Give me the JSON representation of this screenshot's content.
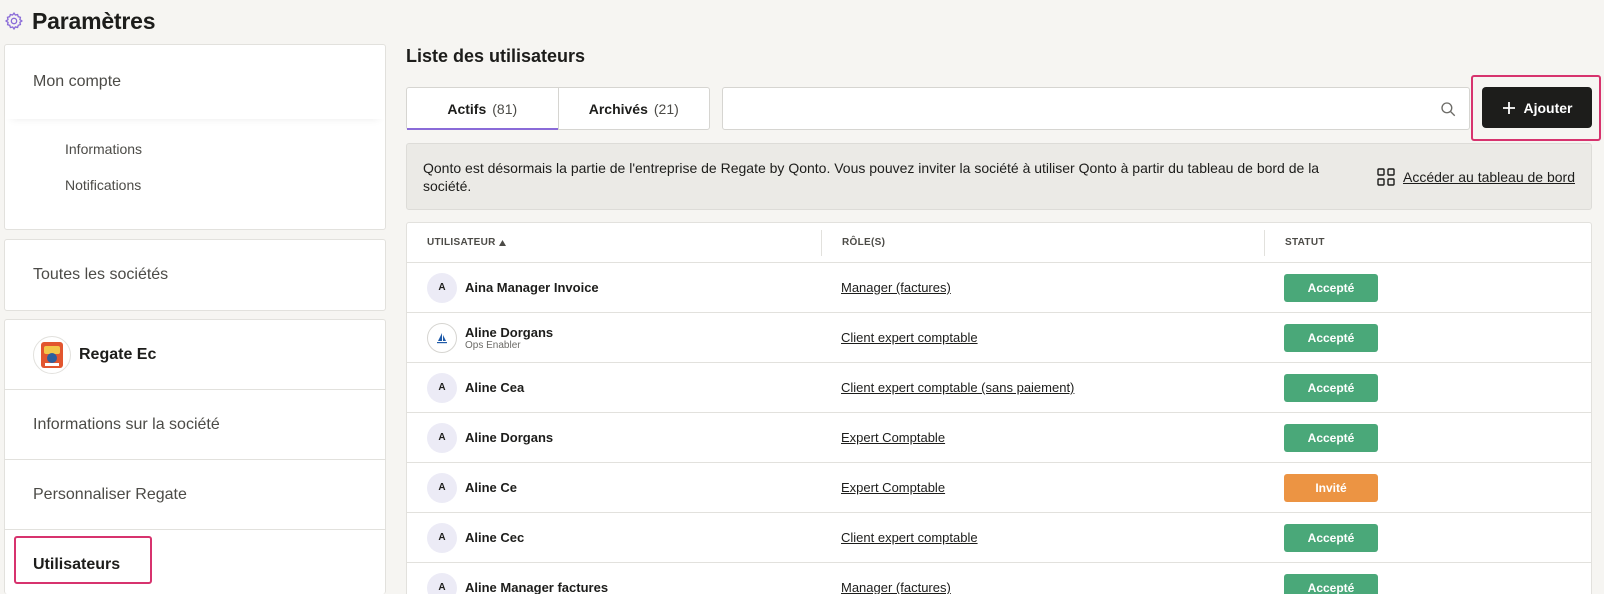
{
  "header": {
    "title": "Paramètres",
    "icon": "gear-icon"
  },
  "sidebar": {
    "account": {
      "title": "Mon compte",
      "items": [
        {
          "label": "Informations"
        },
        {
          "label": "Notifications"
        }
      ]
    },
    "all_companies": "Toutes les sociétés",
    "company": {
      "name": "Regate Ec",
      "items": [
        {
          "label": "Informations sur la société"
        },
        {
          "label": "Personnaliser Regate"
        },
        {
          "label": "Utilisateurs",
          "active": true
        }
      ]
    }
  },
  "main": {
    "title": "Liste des utilisateurs",
    "tabs": [
      {
        "label": "Actifs",
        "count": "(81)",
        "active": true
      },
      {
        "label": "Archivés",
        "count": "(21)",
        "active": false
      }
    ],
    "search": {
      "placeholder": "",
      "value": ""
    },
    "add_button": "Ajouter",
    "notice": {
      "text": "Qonto est désormais la partie de l'entreprise de Regate by Qonto. Vous pouvez inviter la société à utiliser Qonto à partir du tableau de bord de la société.",
      "link": "Accéder au tableau de bord"
    },
    "table": {
      "columns": [
        "UTILISATEUR",
        "RÔLE(S)",
        "STATUT"
      ],
      "rows": [
        {
          "avatar": "A",
          "name": "Aina Manager Invoice",
          "sub": "",
          "role": "Manager (factures)",
          "status": "Accepté"
        },
        {
          "avatar": "logo",
          "name": "Aline Dorgans",
          "sub": "Ops Enabler",
          "role": "Client expert comptable",
          "status": "Accepté"
        },
        {
          "avatar": "A",
          "name": "Aline Cea",
          "sub": "",
          "role": "Client expert comptable (sans paiement)",
          "status": "Accepté"
        },
        {
          "avatar": "A",
          "name": "Aline Dorgans",
          "sub": "",
          "role": "Expert Comptable",
          "status": "Accepté"
        },
        {
          "avatar": "A",
          "name": "Aline Ce",
          "sub": "",
          "role": "Expert Comptable",
          "status": "Invité"
        },
        {
          "avatar": "A",
          "name": "Aline Cec",
          "sub": "",
          "role": "Client expert comptable",
          "status": "Accepté"
        },
        {
          "avatar": "A",
          "name": "Aline Manager factures",
          "sub": "",
          "role": "Manager (factures)",
          "status": "Accepté"
        }
      ]
    }
  },
  "colors": {
    "accepted": "#4aa879",
    "invited": "#ec9443",
    "highlight": "#d7336e",
    "accent": "#8a6bd8",
    "button": "#1d1d1b"
  }
}
